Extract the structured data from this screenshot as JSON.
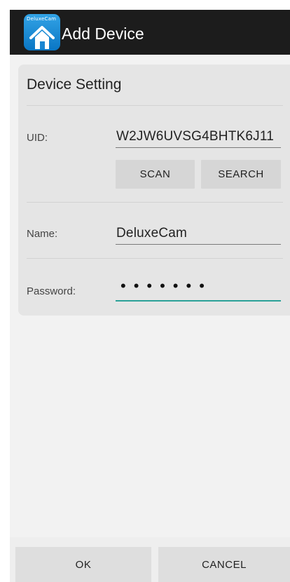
{
  "app_bar": {
    "brand_text": "DeluxeCam",
    "title": "Add Device",
    "icon": "house-icon"
  },
  "card": {
    "title": "Device Setting",
    "uid": {
      "label": "UID:",
      "value": "W2JW6UVSG4BHTK6J11"
    },
    "buttons": {
      "scan_label": "SCAN",
      "search_label": "SEARCH"
    },
    "name": {
      "label": "Name:",
      "value": "DeluxeCam"
    },
    "password": {
      "label": "Password:",
      "masked_value": "•••••••"
    }
  },
  "footer": {
    "ok_label": "OK",
    "cancel_label": "CANCEL"
  },
  "colors": {
    "app_bar": "#1c1c1c",
    "focus_underline": "#2aa198",
    "card": "#e5e5e5"
  }
}
